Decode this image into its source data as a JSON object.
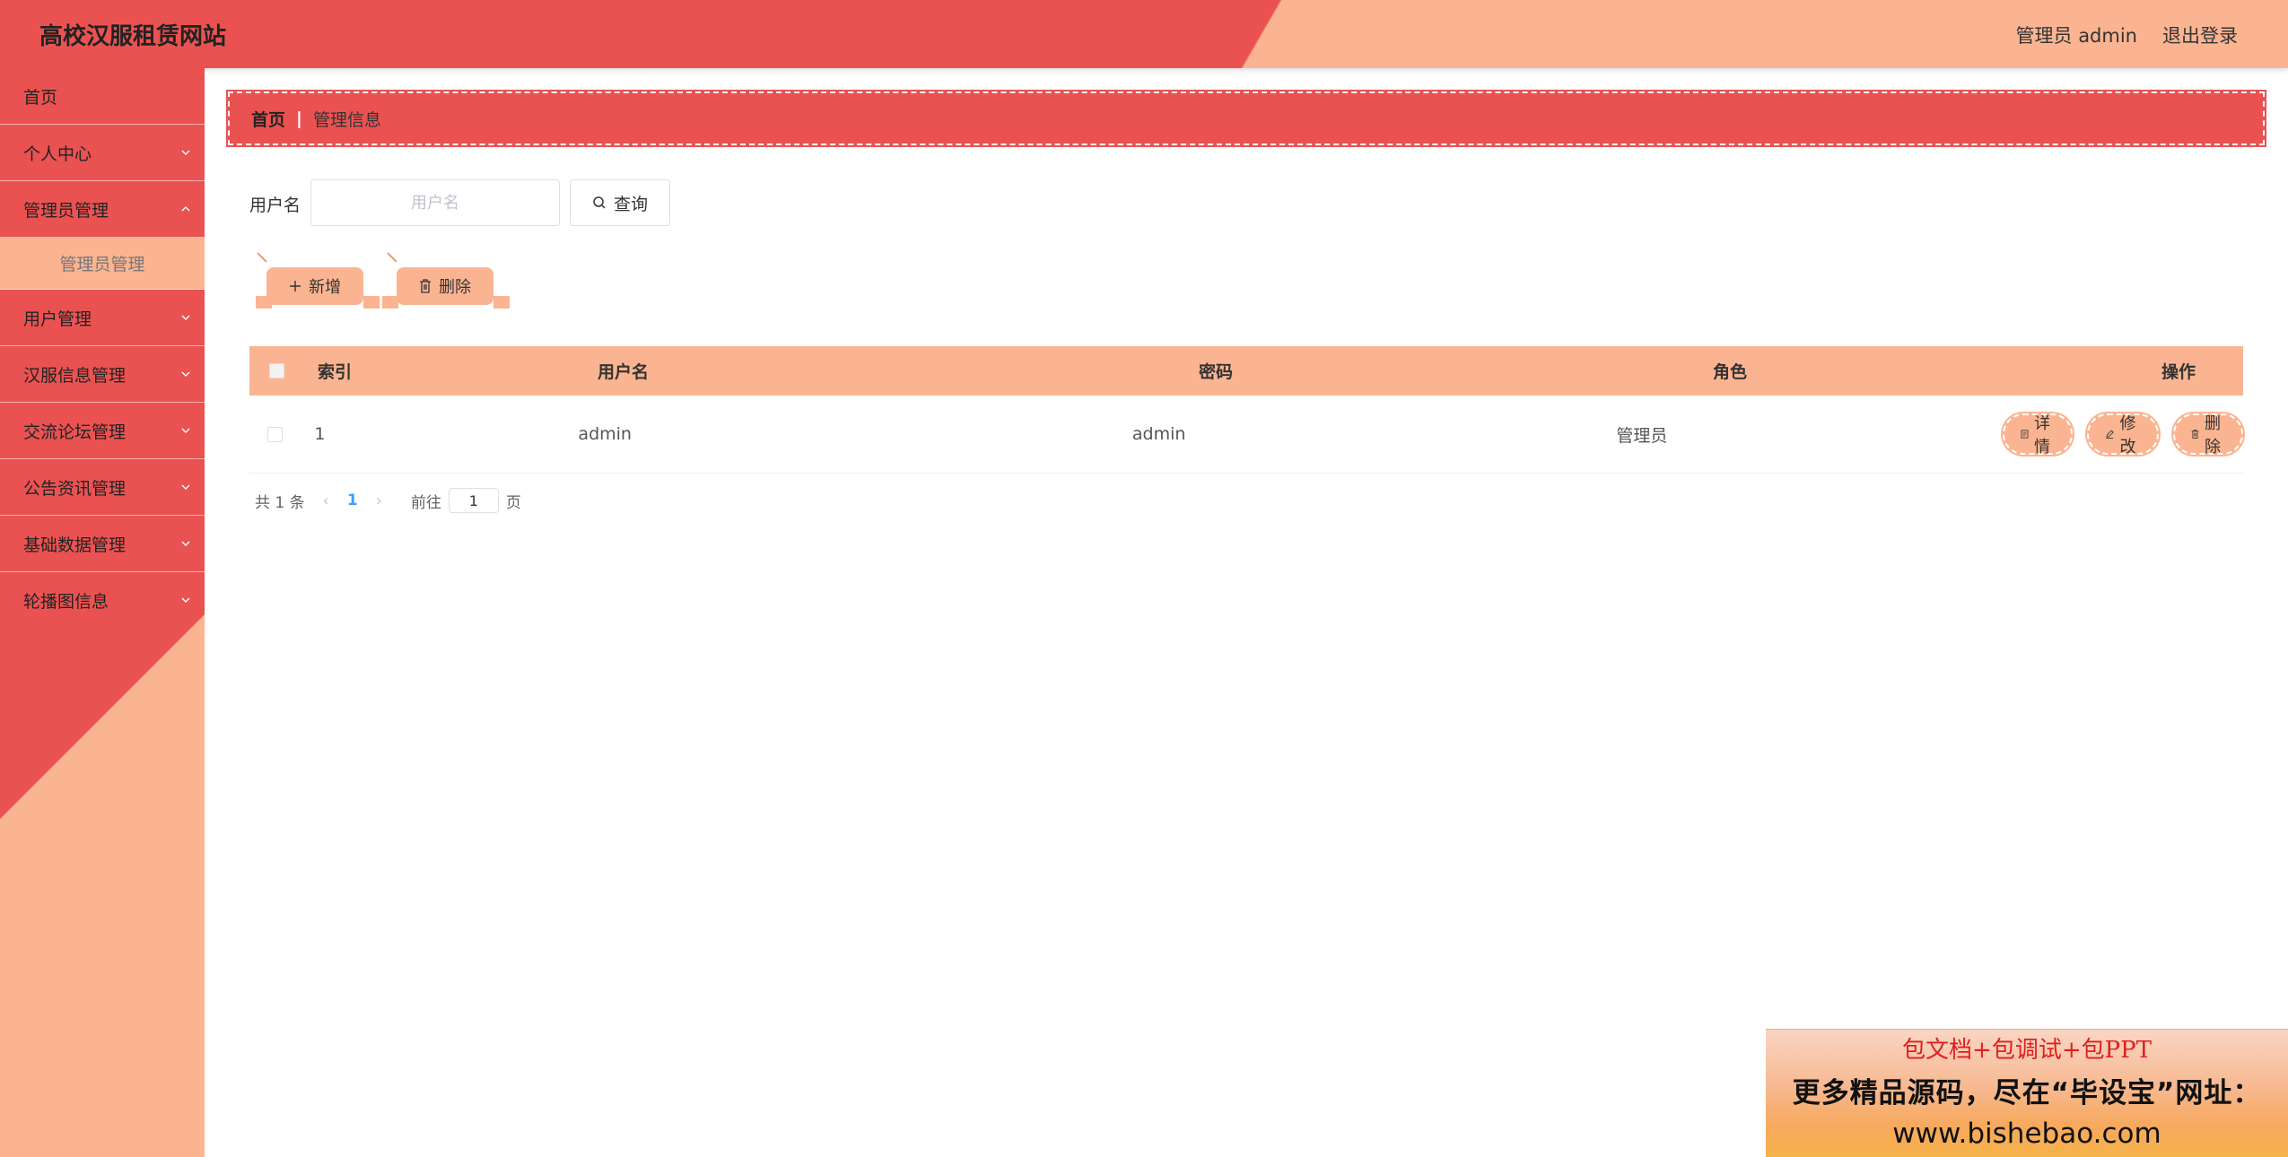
{
  "header": {
    "title": "高校汉服租赁网站",
    "user": "管理员 admin",
    "logout": "退出登录"
  },
  "sidebar": {
    "items": [
      {
        "label": "首页"
      },
      {
        "label": "个人中心"
      },
      {
        "label": "管理员管理"
      },
      {
        "label": "管理员管理"
      },
      {
        "label": "用户管理"
      },
      {
        "label": "汉服信息管理"
      },
      {
        "label": "交流论坛管理"
      },
      {
        "label": "公告资讯管理"
      },
      {
        "label": "基础数据管理"
      },
      {
        "label": "轮播图信息"
      }
    ]
  },
  "breadcrumb": {
    "home": "首页",
    "separator": "|",
    "current": "管理信息"
  },
  "search": {
    "label": "用户名",
    "placeholder": "用户名",
    "value": "",
    "button": "查询"
  },
  "actions": {
    "add": "新增",
    "delete": "删除"
  },
  "table": {
    "headers": [
      "索引",
      "用户名",
      "密码",
      "角色",
      "操作"
    ],
    "rows": [
      {
        "index": "1",
        "username": "admin",
        "password": "admin",
        "role": "管理员"
      }
    ],
    "ops": {
      "detail": "详情",
      "edit": "修改",
      "delete": "删除"
    }
  },
  "pagination": {
    "total": "共 1 条",
    "current_page": "1",
    "goto_label": "前往",
    "goto_value": "1",
    "page_suffix": "页"
  },
  "watermark": {
    "line1": "包文档+包调试+包PPT",
    "line2": "更多精品源码，尽在“毕设宝”网址：",
    "line3": "www.bishebao.com"
  },
  "colors": {
    "primary": "#ea5252",
    "accent": "#fbb491",
    "page_active": "#409eff"
  }
}
